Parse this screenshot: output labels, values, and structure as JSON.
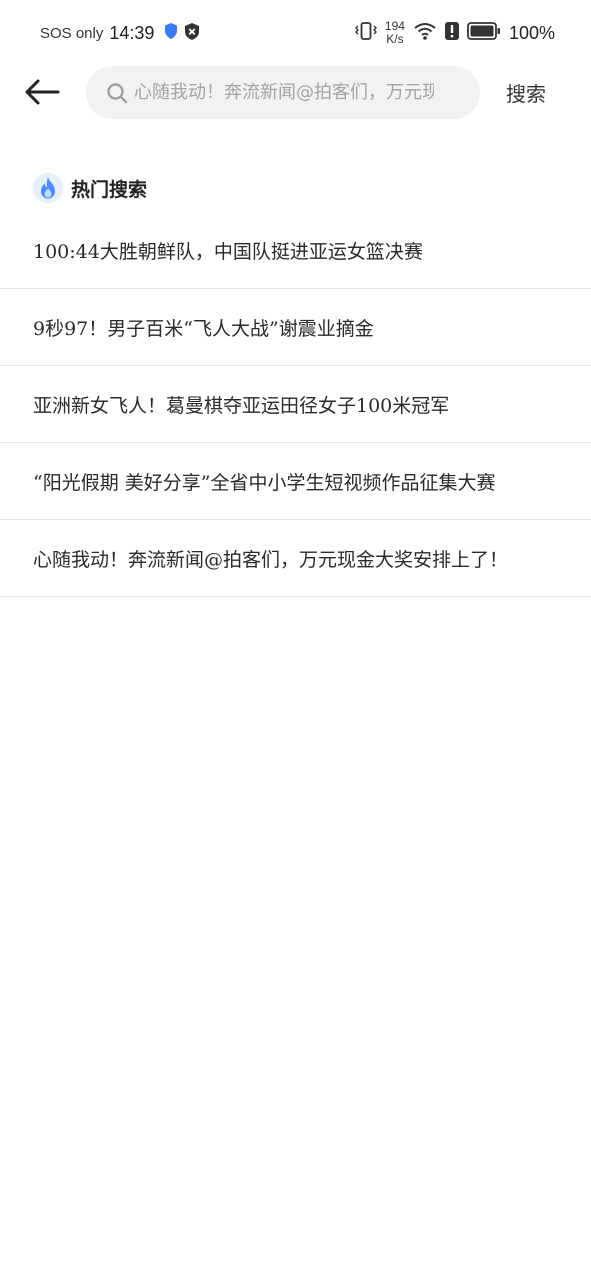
{
  "status_bar": {
    "carrier": "SOS only",
    "time": "14:39",
    "net_speed_value": "194",
    "net_speed_unit": "K/s",
    "battery_percent": "100%",
    "icons": [
      "shield-icon",
      "privacy-icon",
      "vibrate-icon",
      "wifi-icon",
      "alert-icon",
      "battery-icon"
    ]
  },
  "header": {
    "back_icon": "arrow-left-icon",
    "search": {
      "placeholder": "心随我动！奔流新闻@拍客们，万元现金大奖安排上了！",
      "value": ""
    },
    "search_button_label": "搜索"
  },
  "hot_search": {
    "title": "热门搜索",
    "icon": "fire-icon",
    "accent_color": "#4a8df8",
    "items": [
      {
        "text": "100:44大胜朝鲜队，中国队挺进亚运女篮决赛"
      },
      {
        "text": "9秒97！男子百米“飞人大战”谢震业摘金"
      },
      {
        "text": "亚洲新女飞人！葛曼棋夺亚运田径女子100米冠军"
      },
      {
        "text": "“阳光假期 美好分享”全省中小学生短视频作品征集大赛"
      },
      {
        "text": "心随我动！奔流新闻@拍客们，万元现金大奖安排上了！"
      }
    ]
  }
}
